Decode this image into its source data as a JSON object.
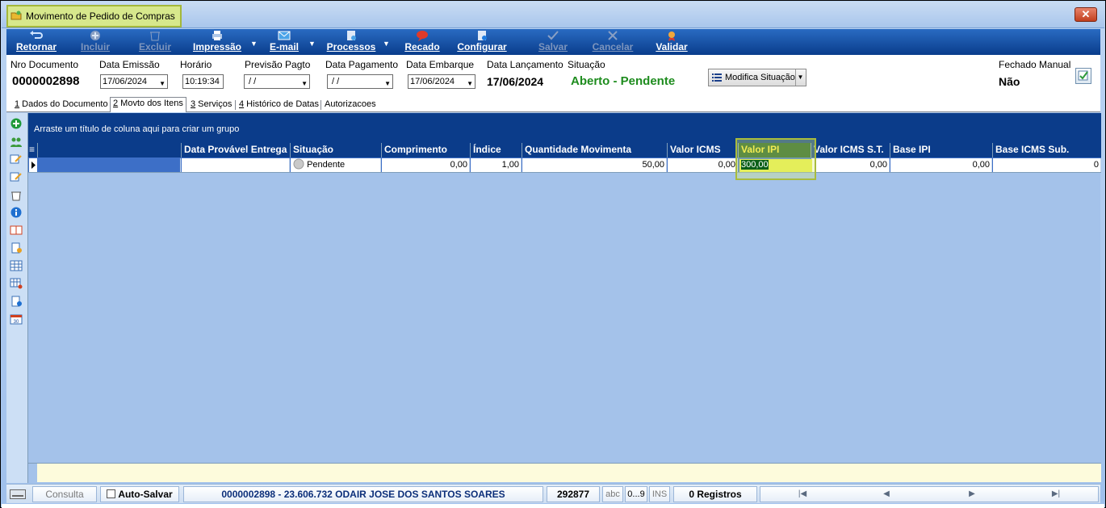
{
  "window": {
    "title": "Movimento de Pedido de Compras",
    "close_label": "✕"
  },
  "toolbar": {
    "retornar": "Retornar",
    "incluir": "Incluir",
    "excluir": "Excluir",
    "impressao": "Impressão",
    "email": "E-mail",
    "processos": "Processos",
    "recado": "Recado",
    "configurar": "Configurar",
    "salvar": "Salvar",
    "cancelar": "Cancelar",
    "validar": "Validar"
  },
  "header": {
    "nro_documento": {
      "label": "Nro Documento",
      "value": "0000002898"
    },
    "data_emissao": {
      "label": "Data Emissão",
      "value": "17/06/2024"
    },
    "horario": {
      "label": "Horário",
      "value": "10:19:34"
    },
    "previsao_pagto": {
      "label": "Previsão Pagto",
      "value": " / /"
    },
    "data_pagamento": {
      "label": "Data Pagamento",
      "value": " / /"
    },
    "data_embarque": {
      "label": "Data Embarque",
      "value": "17/06/2024"
    },
    "data_lancamento": {
      "label": "Data Lançamento",
      "value": "17/06/2024"
    },
    "situacao": {
      "label": "Situação",
      "value": "Aberto - Pendente",
      "color": "#1e8c1e"
    },
    "modifica_situacao": "Modifica Situação",
    "fechado_manual": {
      "label": "Fechado Manual",
      "value": "Não"
    }
  },
  "tabs": [
    {
      "key": "1",
      "label": " Dados do Documento"
    },
    {
      "key": "2",
      "label": " Movto dos Itens"
    },
    {
      "key": "3",
      "label": " Serviços"
    },
    {
      "key": "4",
      "label": " Histórico de Datas"
    },
    {
      "key": "",
      "label": "Autorizacoes"
    }
  ],
  "grid": {
    "group_hint": "Arraste um título de coluna aqui para criar um grupo",
    "columns": [
      "",
      "Data Provável Entrega",
      "Situação",
      "Comprimento",
      "Índice",
      "Quantidade Movimenta",
      "Valor ICMS",
      "Valor IPI",
      "Valor ICMS S.T.",
      "Base IPI",
      "Base ICMS Sub."
    ],
    "row": {
      "col0": "",
      "data_entrega": "",
      "situacao": "Pendente",
      "comprimento": "0,00",
      "indice": "1,00",
      "quantidade": "50,00",
      "valor_icms": "0,00",
      "valor_ipi": "300,00",
      "valor_icms_st": "0,00",
      "base_ipi": "0,00",
      "base_icms_sub": "0"
    }
  },
  "statusbar": {
    "mode": "Consulta",
    "auto_salvar": "Auto-Salvar",
    "document": "0000002898 - 23.606.732 ODAIR JOSE DOS SANTOS SOARES",
    "code": "292877",
    "abc": "abc",
    "range": "0...9",
    "ins": "INS",
    "registros": "0 Registros"
  }
}
